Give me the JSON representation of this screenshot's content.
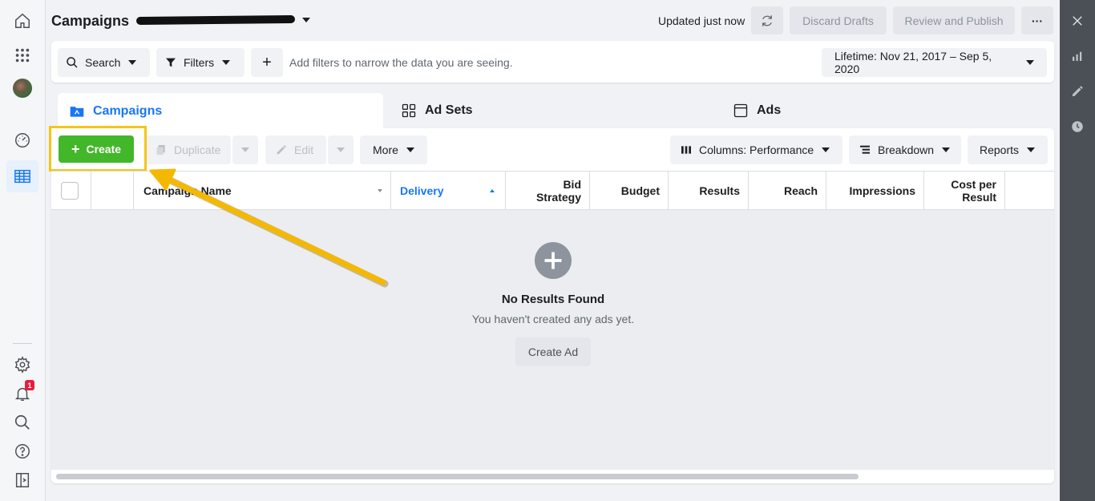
{
  "header": {
    "title": "Campaigns",
    "updated": "Updated just now",
    "discard_label": "Discard Drafts",
    "review_label": "Review and Publish",
    "more_glyph": "···"
  },
  "filterbar": {
    "search_label": "Search",
    "filters_label": "Filters",
    "add_glyph": "+",
    "hint": "Add filters to narrow the data you are seeing.",
    "date_range": "Lifetime: Nov 21, 2017 – Sep 5, 2020"
  },
  "tabs": [
    {
      "label": "Campaigns"
    },
    {
      "label": "Ad Sets"
    },
    {
      "label": "Ads"
    }
  ],
  "toolbar": {
    "create_label": "Create",
    "duplicate_label": "Duplicate",
    "edit_label": "Edit",
    "more_label": "More",
    "columns_label": "Columns: Performance",
    "breakdown_label": "Breakdown",
    "reports_label": "Reports"
  },
  "table": {
    "columns": [
      "Campaign Name",
      "Delivery",
      "Bid Strategy",
      "Budget",
      "Results",
      "Reach",
      "Impressions",
      "Cost per Result"
    ],
    "bid_line1": "Bid",
    "bid_line2": "Strategy",
    "cost_line1": "Cost per",
    "cost_line2": "Result"
  },
  "empty": {
    "title": "No Results Found",
    "subtitle": "You haven't created any ads yet.",
    "button_label": "Create Ad"
  },
  "nav": {
    "notification_count": "1"
  },
  "colors": {
    "accent": "#1877f2",
    "create_green": "#42b72a",
    "highlight": "#f5c518",
    "rail": "#4b4f56"
  }
}
